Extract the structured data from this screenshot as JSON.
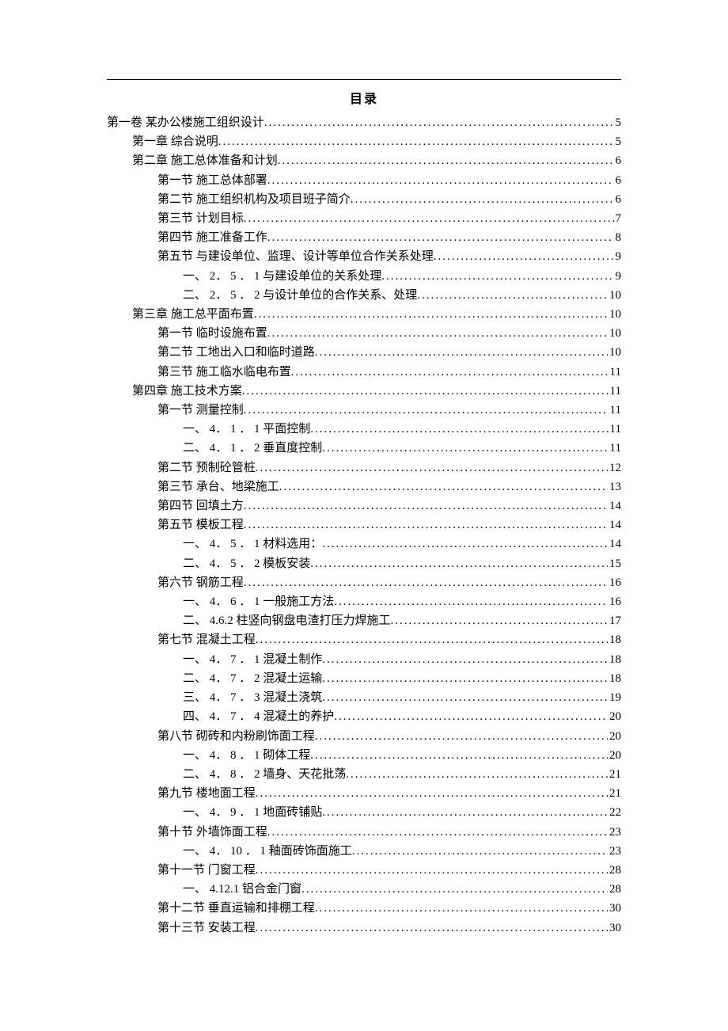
{
  "title": "目录",
  "toc": [
    {
      "level": 0,
      "label": "第一卷 某办公楼施工组织设计",
      "page": "5"
    },
    {
      "level": 1,
      "label": "第一章 综合说明",
      "page": "5"
    },
    {
      "level": 1,
      "label": "第二章 施工总体准备和计划",
      "page": "6"
    },
    {
      "level": 2,
      "label": "第一节 施工总体部署",
      "page": "6"
    },
    {
      "level": 2,
      "label": "第二节 施工组织机构及项目班子简介",
      "page": "6"
    },
    {
      "level": 2,
      "label": "第三节 计划目标",
      "page": "7"
    },
    {
      "level": 2,
      "label": "第四节 施工准备工作",
      "page": "8"
    },
    {
      "level": 2,
      "label": "第五节 与建设单位、监理、设计等单位合作关系处理",
      "page": "9"
    },
    {
      "level": 3,
      "label": "一、 2． 5 ． 1 与建设单位的关系处理",
      "page": "9"
    },
    {
      "level": 3,
      "label": "二、 2． 5 ． 2 与设计单位的合作关系、处理",
      "page": "10"
    },
    {
      "level": 1,
      "label": "第三章 施工总平面布置",
      "page": "10"
    },
    {
      "level": 2,
      "label": "第一节 临时设施布置",
      "page": "10"
    },
    {
      "level": 2,
      "label": "第二节 工地出入口和临时道路",
      "page": "10"
    },
    {
      "level": 2,
      "label": "第三节 施工临水临电布置",
      "page": "11"
    },
    {
      "level": 1,
      "label": "第四章 施工技术方案",
      "page": "11"
    },
    {
      "level": 2,
      "label": "第一节 测量控制",
      "page": "11"
    },
    {
      "level": 3,
      "label": "一、 4． 1 ． 1 平面控制",
      "page": "11"
    },
    {
      "level": 3,
      "label": "二、 4． 1 ． 2 垂直度控制",
      "page": "11"
    },
    {
      "level": 2,
      "label": "第二节 预制砼管桩",
      "page": "12"
    },
    {
      "level": 2,
      "label": "第三节 承台、地梁施工",
      "page": "13"
    },
    {
      "level": 2,
      "label": "第四节 回填土方",
      "page": "14"
    },
    {
      "level": 2,
      "label": "第五节 模板工程",
      "page": "14"
    },
    {
      "level": 3,
      "label": "一、 4． 5 ． 1 材料选用：",
      "page": "14"
    },
    {
      "level": 3,
      "label": "二、 4． 5 ． 2 模板安装",
      "page": "15"
    },
    {
      "level": 2,
      "label": "第六节 钢筋工程",
      "page": "16"
    },
    {
      "level": 3,
      "label": "一、 4． 6 ． 1 一般施工方法",
      "page": "16"
    },
    {
      "level": 3,
      "label": "二、 4.6.2  柱竖向钢盘电渣打压力焊施工",
      "page": "17"
    },
    {
      "level": 2,
      "label": "第七节 混凝土工程",
      "page": "18"
    },
    {
      "level": 3,
      "label": "一、 4． 7 ． 1 混凝土制作",
      "page": "18"
    },
    {
      "level": 3,
      "label": "二、 4． 7 ． 2 混凝土运输",
      "page": "18"
    },
    {
      "level": 3,
      "label": "三、 4． 7 ． 3 混凝土浇筑",
      "page": "19"
    },
    {
      "level": 3,
      "label": "四、 4． 7 ． 4 混凝土的养护",
      "page": "20"
    },
    {
      "level": 2,
      "label": "第八节 砌砖和内粉刷饰面工程",
      "page": "20"
    },
    {
      "level": 3,
      "label": "一、 4． 8 ． 1 砌体工程",
      "page": "20"
    },
    {
      "level": 3,
      "label": "二、 4． 8 ． 2 墙身、天花批荡",
      "page": "21"
    },
    {
      "level": 2,
      "label": "第九节 楼地面工程",
      "page": "21"
    },
    {
      "level": 3,
      "label": "一、 4． 9 ． 1 地面砖铺贴",
      "page": "22"
    },
    {
      "level": 2,
      "label": "第十节 外墙饰面工程",
      "page": "23"
    },
    {
      "level": 3,
      "label": "一、 4． 10 ． 1 釉面砖饰面施工",
      "page": "23"
    },
    {
      "level": 2,
      "label": "第十一节 门窗工程",
      "page": "28"
    },
    {
      "level": 3,
      "label": "一、 4.12.1  铝合金门窗",
      "page": "28"
    },
    {
      "level": 2,
      "label": "第十二节 垂直运输和排棚工程",
      "page": "30"
    },
    {
      "level": 2,
      "label": "第十三节 安装工程",
      "page": "30"
    }
  ]
}
